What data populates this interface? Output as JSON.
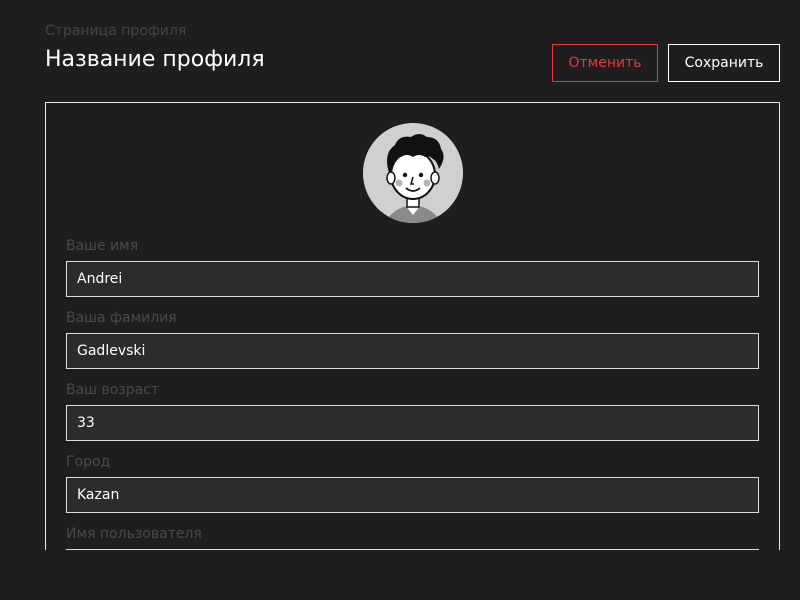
{
  "header": {
    "breadcrumb": "Страница профиля",
    "title": "Название профиля",
    "cancel_label": "Отменить",
    "save_label": "Сохранить"
  },
  "profile": {
    "avatar_icon": "user-avatar-illustration",
    "fields": [
      {
        "label": "Ваше имя",
        "value": "Andrei"
      },
      {
        "label": "Ваша фамилия",
        "value": "Gadlevski"
      },
      {
        "label": "Ваш возраст",
        "value": "33"
      },
      {
        "label": "Город",
        "value": "Kazan"
      },
      {
        "label": "Имя пользователя",
        "value": ""
      }
    ]
  },
  "colors": {
    "background": "#1e1e1f",
    "accent_cancel": "#e5383b",
    "input_bg": "#2c2c2f",
    "border": "#e8e8e8"
  }
}
